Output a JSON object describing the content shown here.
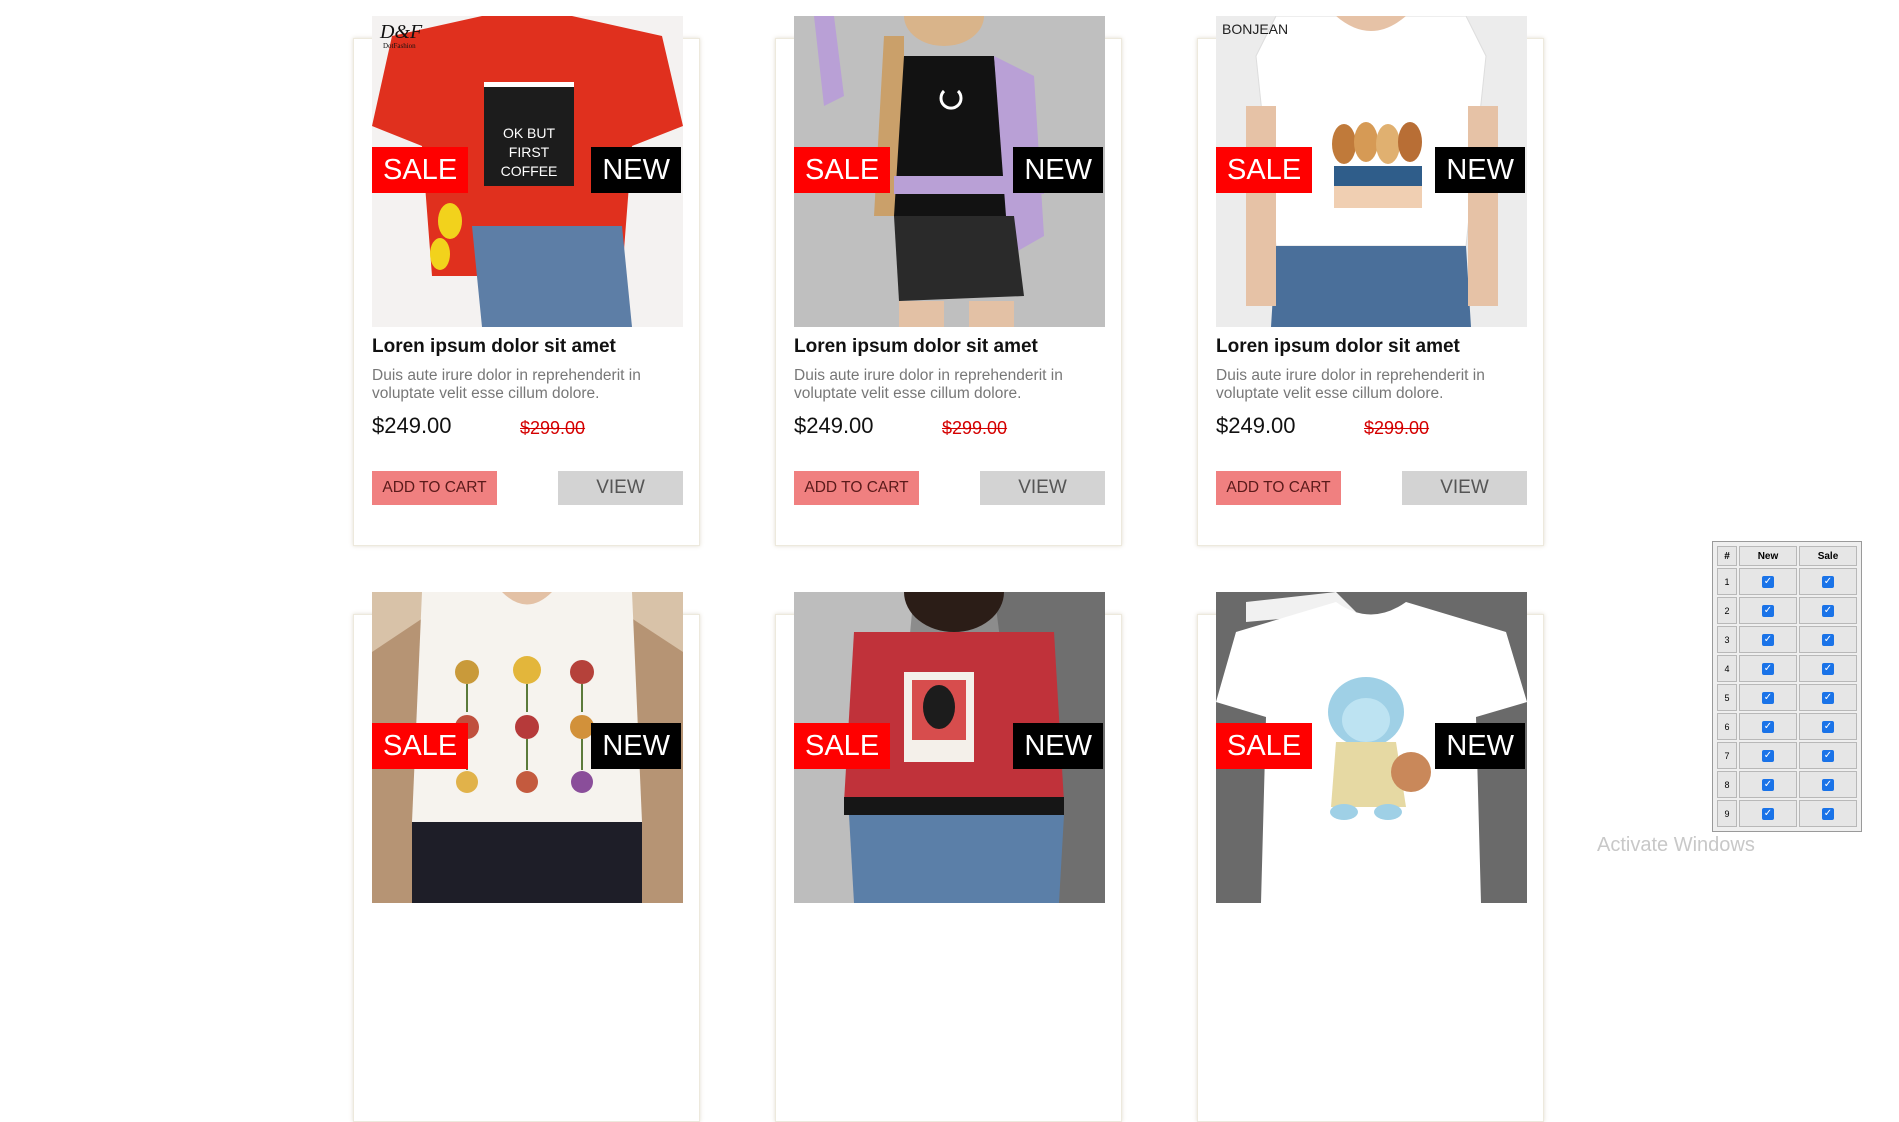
{
  "badges": {
    "sale": "SALE",
    "new": "NEW"
  },
  "products": [
    {
      "title": "Loren ipsum dolor sit amet",
      "description": "Duis aute irure dolor in reprehenderit in voluptate velit esse cillum dolore.",
      "price": "$249.00",
      "old_price": "$299.00",
      "cart_label": "ADD TO CART",
      "view_label": "VIEW",
      "image_logo": "D&F",
      "image_sub": "DotFashion",
      "shirt_text": "OK BUT FIRST COFFEE"
    },
    {
      "title": "Loren ipsum dolor sit amet",
      "description": "Duis aute irure dolor in reprehenderit in voluptate velit esse cillum dolore.",
      "price": "$249.00",
      "old_price": "$299.00",
      "cart_label": "ADD TO CART",
      "view_label": "VIEW"
    },
    {
      "title": "Loren ipsum dolor sit amet",
      "description": "Duis aute irure dolor in reprehenderit in voluptate velit esse cillum dolore.",
      "price": "$249.00",
      "old_price": "$299.00",
      "cart_label": "ADD TO CART",
      "view_label": "VIEW",
      "image_logo": "BONJEAN"
    },
    {
      "title": "",
      "description": "",
      "price": "",
      "old_price": "",
      "cart_label": "",
      "view_label": ""
    },
    {
      "title": "",
      "description": "",
      "price": "",
      "old_price": "",
      "cart_label": "",
      "view_label": ""
    },
    {
      "title": "",
      "description": "",
      "price": "",
      "old_price": "",
      "cart_label": "",
      "view_label": ""
    }
  ],
  "control_table": {
    "headers": [
      "#",
      "New",
      "Sale"
    ],
    "rows": [
      "1",
      "2",
      "3",
      "4",
      "5",
      "6",
      "7",
      "8",
      "9"
    ],
    "all_checked": true
  },
  "watermark": "Activate Windows",
  "colors": {
    "sale": "#ff0000",
    "new": "#000000",
    "cart_button": "#f08080",
    "view_button": "#d3d3d3",
    "old_price": "#d40000"
  }
}
